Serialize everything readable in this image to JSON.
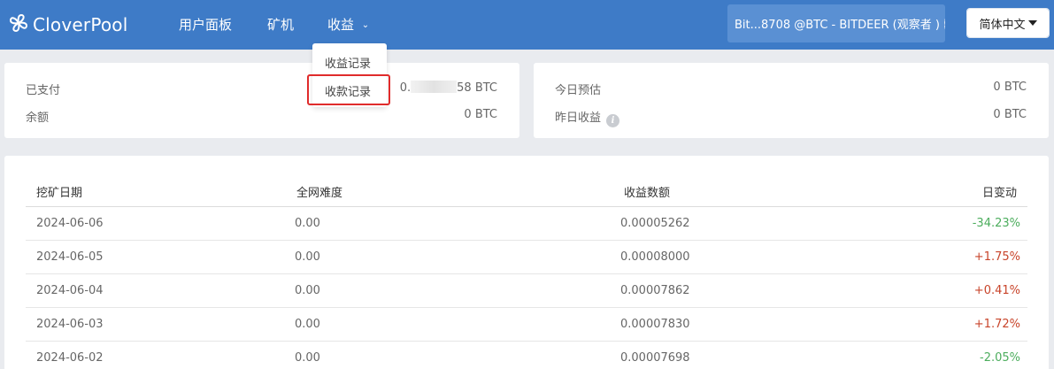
{
  "header": {
    "logo_text": "CloverPool",
    "nav": [
      {
        "label": "用户面板"
      },
      {
        "label": "矿机"
      },
      {
        "label": "收益"
      }
    ],
    "account_label": "Bit...8708 @BTC - BITDEER (观察者 )",
    "language_label": "简体中文"
  },
  "dropdown": {
    "items": [
      {
        "label": "收益记录"
      },
      {
        "label": "收款记录"
      }
    ]
  },
  "summary_left": {
    "paid_label": "已支付",
    "paid_value_prefix": "0.",
    "paid_value_suffix": "58 BTC",
    "balance_label": "余额",
    "balance_value": "0 BTC"
  },
  "summary_right": {
    "today_label": "今日预估",
    "today_value": "0 BTC",
    "yesterday_label": "昨日收益",
    "yesterday_value": "0 BTC"
  },
  "table": {
    "headers": [
      "挖矿日期",
      "全网难度",
      "收益数额",
      "日变动"
    ],
    "rows": [
      {
        "date": "2024-06-06",
        "difficulty": "0.00",
        "amount": "0.00005262",
        "change": "-34.23%"
      },
      {
        "date": "2024-06-05",
        "difficulty": "0.00",
        "amount": "0.00008000",
        "change": "+1.75%"
      },
      {
        "date": "2024-06-04",
        "difficulty": "0.00",
        "amount": "0.00007862",
        "change": "+0.41%"
      },
      {
        "date": "2024-06-03",
        "difficulty": "0.00",
        "amount": "0.00007830",
        "change": "+1.72%"
      },
      {
        "date": "2024-06-02",
        "difficulty": "0.00",
        "amount": "0.00007698",
        "change": "-2.05%"
      }
    ]
  },
  "colors": {
    "header_bg": "#3e7bc7",
    "negative": "#4cad5d",
    "positive": "#c8442a",
    "highlight": "#e02b2b"
  }
}
